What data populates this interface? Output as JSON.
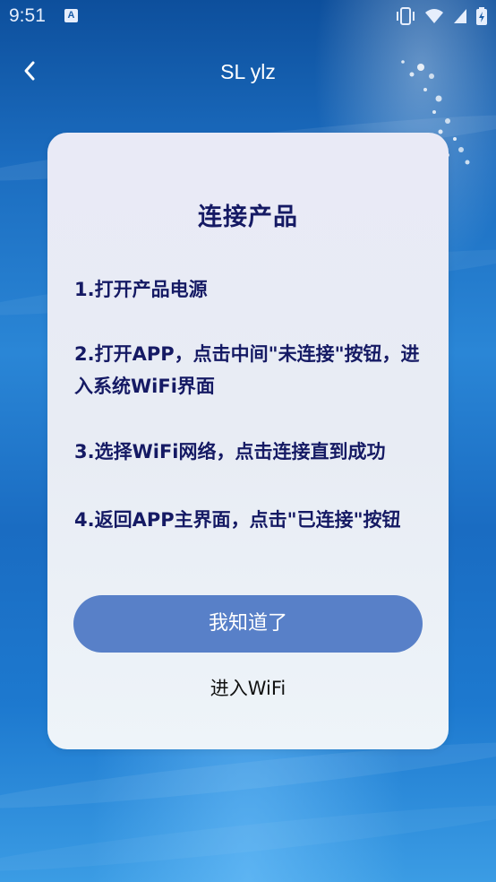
{
  "status_bar": {
    "time": "9:51",
    "notification_badge": "A",
    "icons": [
      "vibrate-icon",
      "wifi-icon",
      "signal-icon",
      "battery-icon"
    ]
  },
  "header": {
    "title": "SL ylz",
    "back_icon": "chevron-left-icon"
  },
  "card": {
    "title": "连接产品",
    "steps": [
      "1.打开产品电源",
      "2.打开APP，点击中间\"未连接\"按钮，进入系统WiFi界面",
      "3.选择WiFi网络，点击连接直到成功",
      "4.返回APP主界面，点击\"已连接\"按钮"
    ],
    "confirm_label": "我知道了",
    "wifi_label": "进入WiFi"
  },
  "colors": {
    "accent": "#5880c8",
    "heading_text": "#151a64",
    "card_background": "#e9ecf5"
  }
}
